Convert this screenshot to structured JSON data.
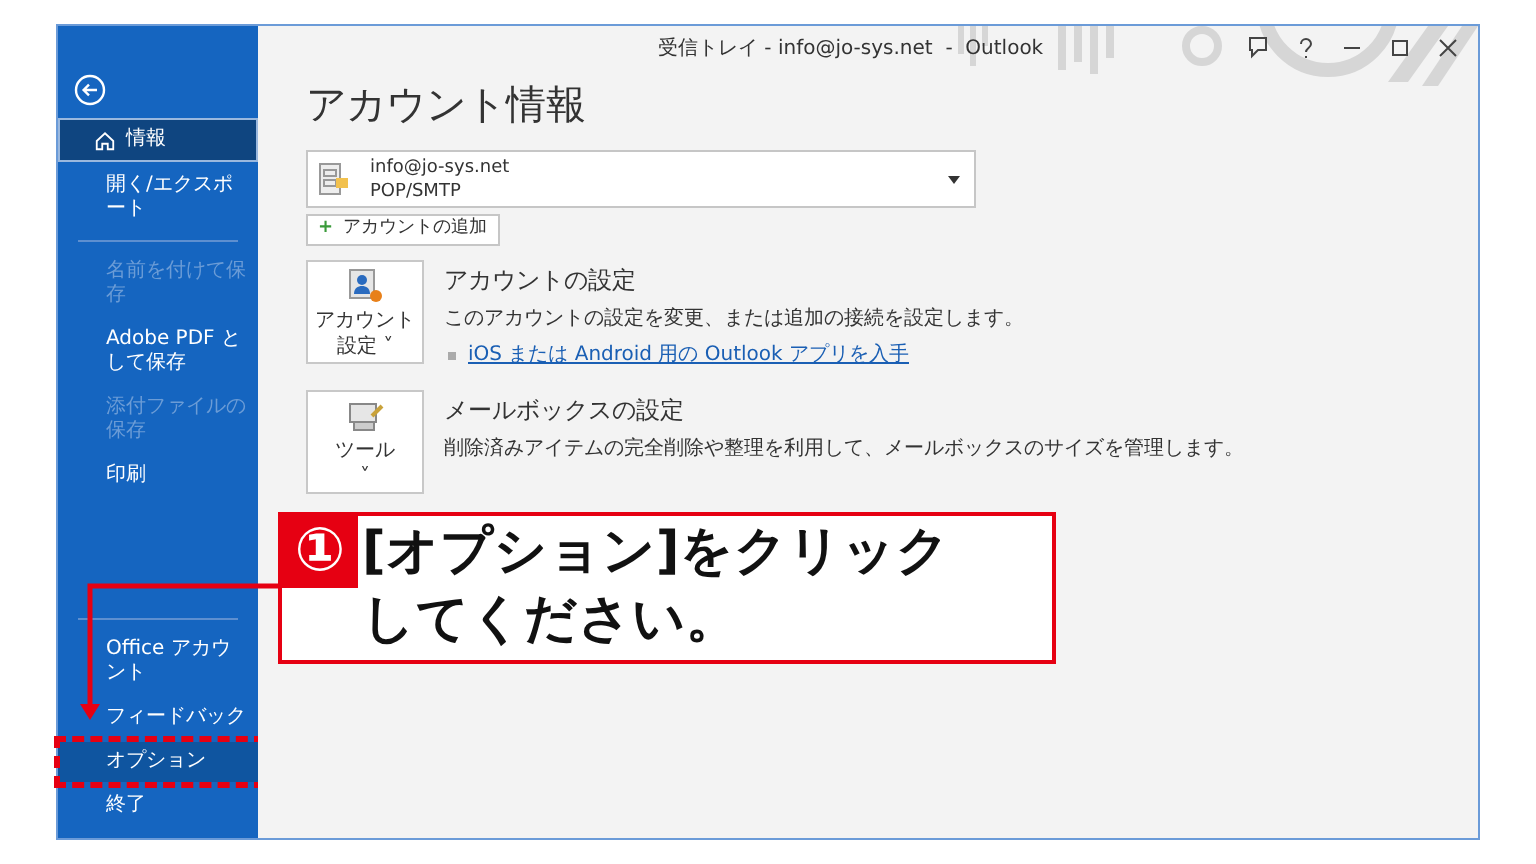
{
  "window": {
    "title": "受信トレイ - info@jo-sys.net  -  Outlook"
  },
  "sidebar": {
    "items": [
      {
        "kind": "back"
      },
      {
        "kind": "item",
        "label": "情報",
        "selected": true,
        "disabled": false,
        "highlighted": false
      },
      {
        "kind": "item",
        "label": "開く/エクスポート",
        "selected": false,
        "disabled": false,
        "highlighted": false
      },
      {
        "kind": "divider"
      },
      {
        "kind": "item",
        "label": "名前を付けて保存",
        "selected": false,
        "disabled": true,
        "highlighted": false
      },
      {
        "kind": "item",
        "label": "Adobe PDF として保存",
        "selected": false,
        "disabled": false,
        "highlighted": false
      },
      {
        "kind": "item",
        "label": "添付ファイルの保存",
        "selected": false,
        "disabled": true,
        "highlighted": false
      },
      {
        "kind": "item",
        "label": "印刷",
        "selected": false,
        "disabled": false,
        "highlighted": false
      },
      {
        "kind": "spacer"
      },
      {
        "kind": "divider"
      },
      {
        "kind": "item",
        "label": "Office アカウント",
        "selected": false,
        "disabled": false,
        "highlighted": false
      },
      {
        "kind": "item",
        "label": "フィードバック",
        "selected": false,
        "disabled": false,
        "highlighted": false
      },
      {
        "kind": "item",
        "label": "オプション",
        "selected": false,
        "disabled": false,
        "highlighted": true
      },
      {
        "kind": "item",
        "label": "終了",
        "selected": false,
        "disabled": false,
        "highlighted": false
      }
    ]
  },
  "main": {
    "heading": "アカウント情報",
    "account": {
      "email": "info@jo-sys.net",
      "type": "POP/SMTP"
    },
    "add_button": {
      "icon": "+",
      "label": "アカウントの追加"
    },
    "cards": [
      {
        "kind": "account",
        "button": [
          "アカウント",
          "設定 ˅"
        ],
        "title": "アカウントの設定",
        "description": "このアカウントの設定を変更、または追加の接続を設定します。",
        "link": "iOS または Android 用の Outlook アプリを入手"
      },
      {
        "kind": "tools",
        "button": [
          "ツール",
          "˅"
        ],
        "title": "メールボックスの設定",
        "description": "削除済みアイテムの完全削除や整理を利用して、メールボックスのサイズを管理します。"
      }
    ]
  },
  "callout": {
    "number": "①",
    "lines": [
      "[オプション]をクリック",
      "してください。"
    ]
  }
}
